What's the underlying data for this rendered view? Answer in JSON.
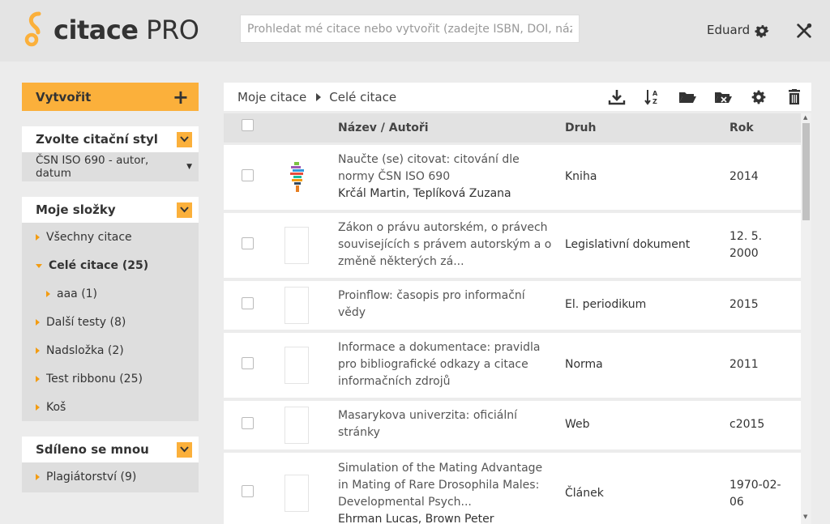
{
  "header": {
    "logo_bold": "citace",
    "logo_light": "PRO",
    "search_placeholder": "Prohledat mé citace nebo vytvořit (zadejte ISBN, DOI, název)",
    "user_name": "Eduard"
  },
  "sidebar": {
    "create_label": "Vytvořit",
    "create_plus": "+",
    "style_section": {
      "title": "Zvolte citační styl",
      "selected": "ČSN ISO 690 - autor, datum"
    },
    "folders_section": {
      "title": "Moje složky",
      "items": [
        {
          "label": "Všechny citace"
        },
        {
          "label": "Celé citace (25)"
        },
        {
          "label": "aaa (1)"
        },
        {
          "label": "Další testy (8)"
        },
        {
          "label": "Nadsložka (2)"
        },
        {
          "label": "Test ribbonu (25)"
        },
        {
          "label": "Koš"
        }
      ]
    },
    "shared_section": {
      "title": "Sdíleno se mnou",
      "items": [
        {
          "label": "Plagiátorství (9)"
        }
      ]
    }
  },
  "main": {
    "breadcrumb": [
      "Moje citace",
      "Celé citace"
    ],
    "columns": {
      "title": "Název / Autoři",
      "type": "Druh",
      "year": "Rok"
    },
    "rows": [
      {
        "title_l1": "Naučte (se) citovat: citování dle",
        "title_l2": "normy ČSN ISO 690",
        "title_l3": "",
        "authors": "Krčál Martin, Teplíková Zuzana",
        "type": "Kniha",
        "year_l1": "2014",
        "year_l2": ""
      },
      {
        "title_l1": "Zákon o právu autorském, o právech",
        "title_l2": "souvisejících s právem autorským a o",
        "title_l3": "změně některých zá...",
        "authors": "",
        "type": "Legislativní dokument",
        "year_l1": "12. 5.",
        "year_l2": "2000"
      },
      {
        "title_l1": "Proinflow: časopis pro informační",
        "title_l2": "vědy",
        "title_l3": "",
        "authors": "",
        "type": "El. periodikum",
        "year_l1": "2015",
        "year_l2": ""
      },
      {
        "title_l1": "Informace a dokumentace: pravidla",
        "title_l2": "pro bibliografické odkazy a citace",
        "title_l3": "informačních zdrojů",
        "authors": "",
        "type": "Norma",
        "year_l1": "2011",
        "year_l2": ""
      },
      {
        "title_l1": "Masarykova univerzita: oficiální",
        "title_l2": "stránky",
        "title_l3": "",
        "authors": "",
        "type": "Web",
        "year_l1": "c2015",
        "year_l2": ""
      },
      {
        "title_l1": "Simulation of the Mating Advantage",
        "title_l2": "in Mating of Rare Drosophila Males:",
        "title_l3": "Developmental Psych...",
        "authors": "Ehrman Lucas, Brown Peter",
        "type": "Článek",
        "year_l1": "1970-02-",
        "year_l2": "06"
      }
    ]
  },
  "colors": {
    "accent": "#fbb03b",
    "arrow": "#f39c12",
    "header_bg": "#e4e4e4",
    "page_bg": "#ececec"
  },
  "icons": [
    "settings-gear-icon",
    "tools-icon",
    "download-icon",
    "sort-az-icon",
    "folder-open-icon",
    "folder-export-icon",
    "gear-icon",
    "trash-icon",
    "chevron-down-icon"
  ]
}
